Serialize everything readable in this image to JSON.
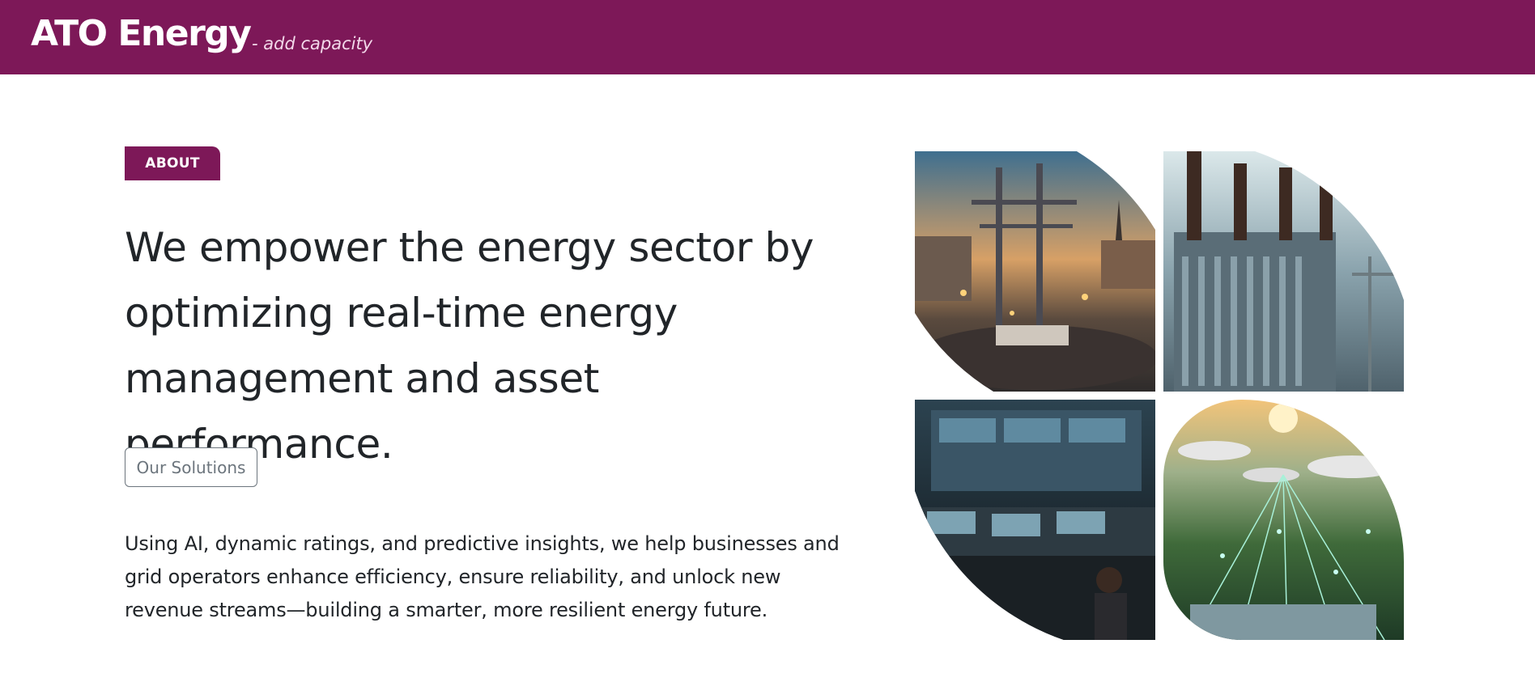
{
  "header": {
    "brand": "ATO Energy",
    "tagline": "- add capacity"
  },
  "about": {
    "badge": "ABOUT",
    "headline": "We empower the energy sector by optimizing real-time energy management and asset performance.",
    "cta_label": "Our Solutions",
    "description": "Using AI, dynamic ratings, and predictive insights, we help businesses and grid operators enhance efficiency, ensure reliability, and unlock new revenue streams—building a smarter, more resilient energy future."
  },
  "colors": {
    "brand": "#7d1858",
    "tagline": "#f3d9ea",
    "text": "#212529",
    "button_border": "#6c757d"
  }
}
